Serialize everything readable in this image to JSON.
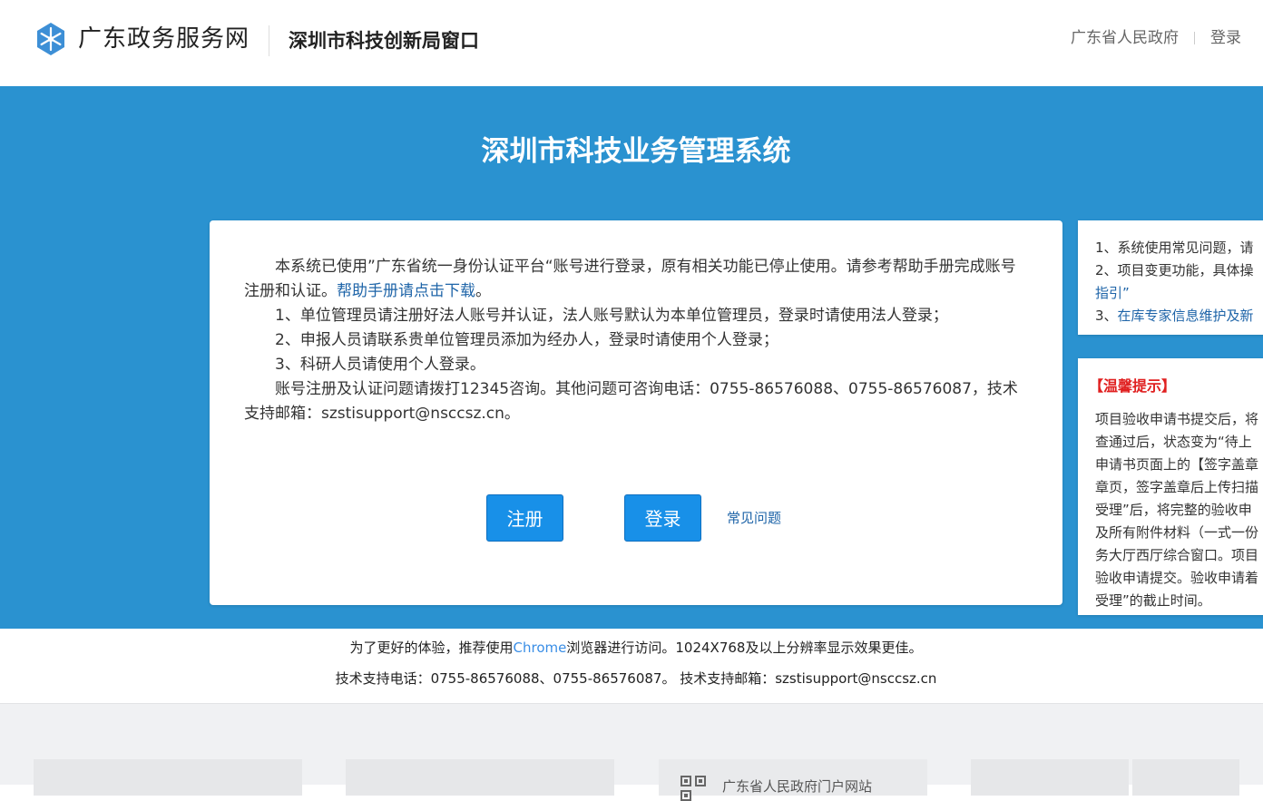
{
  "header": {
    "logo_text": "广东政务服务网",
    "window_title": "深圳市科技创新局窗口",
    "gov_link": "广东省人民政府",
    "login_link": "登录"
  },
  "banner": {
    "title": "深圳市科技业务管理系统"
  },
  "notice": {
    "intro": "本系统已使用”广东省统一身份认证平台“账号进行登录，原有相关功能已停止使用。请参考帮助手册完成账号注册和认证。",
    "manual_link": "帮助手册请点击下载",
    "intro_end": "。",
    "item1": "1、单位管理员请注册好法人账号并认证，法人账号默认为本单位管理员，登录时请使用法人登录；",
    "item2": "2、申报人员请联系贵单位管理员添加为经办人，登录时请使用个人登录；",
    "item3": "3、科研人员请使用个人登录。",
    "contact": "账号注册及认证问题请拨打12345咨询。其他问题可咨询电话：0755-86576088、0755-86576087，技术支持邮箱：szstisupport@nsccsz.cn。",
    "register_label": "注册",
    "login_label": "登录",
    "faq_label": "常见问题"
  },
  "side_panel_1": {
    "item1": "1、系统使用常见问题，请",
    "item2_text": "2、项目变更功能，具体操",
    "item2_link": "指引”",
    "item3_prefix": "3、",
    "item3_link": "在库专家信息维护及新"
  },
  "side_panel_2": {
    "title": "【温馨提示】",
    "lines": [
      "项目验收申请书提交后，将",
      "查通过后，状态变为“待上",
      "申请书页面上的【签字盖章",
      "章页，签字盖章后上传扫描",
      "受理”后，将完整的验收申",
      "及所有附件材料（一式一份",
      "务大厅西厅综合窗口。项目",
      "验收申请提交。验收申请着",
      "受理”的截止时间。"
    ]
  },
  "info": {
    "line1_pre": "为了更好的体验，推荐使用",
    "chrome_link": "Chrome",
    "line1_post": "浏览器进行访问。1024X768及以上分辨率显示效果更佳。",
    "line2": "技术支持电话：0755-86576088、0755-86576087。 技术支持邮箱：szstisupport@nsccsz.cn"
  },
  "bottom": {
    "tile3_text": "广东省人民政府门户网站"
  },
  "colors": {
    "banner_blue": "#2a92d0",
    "button_blue": "#1890e8",
    "link_blue": "#1e64a8",
    "tip_red": "#e02020"
  }
}
